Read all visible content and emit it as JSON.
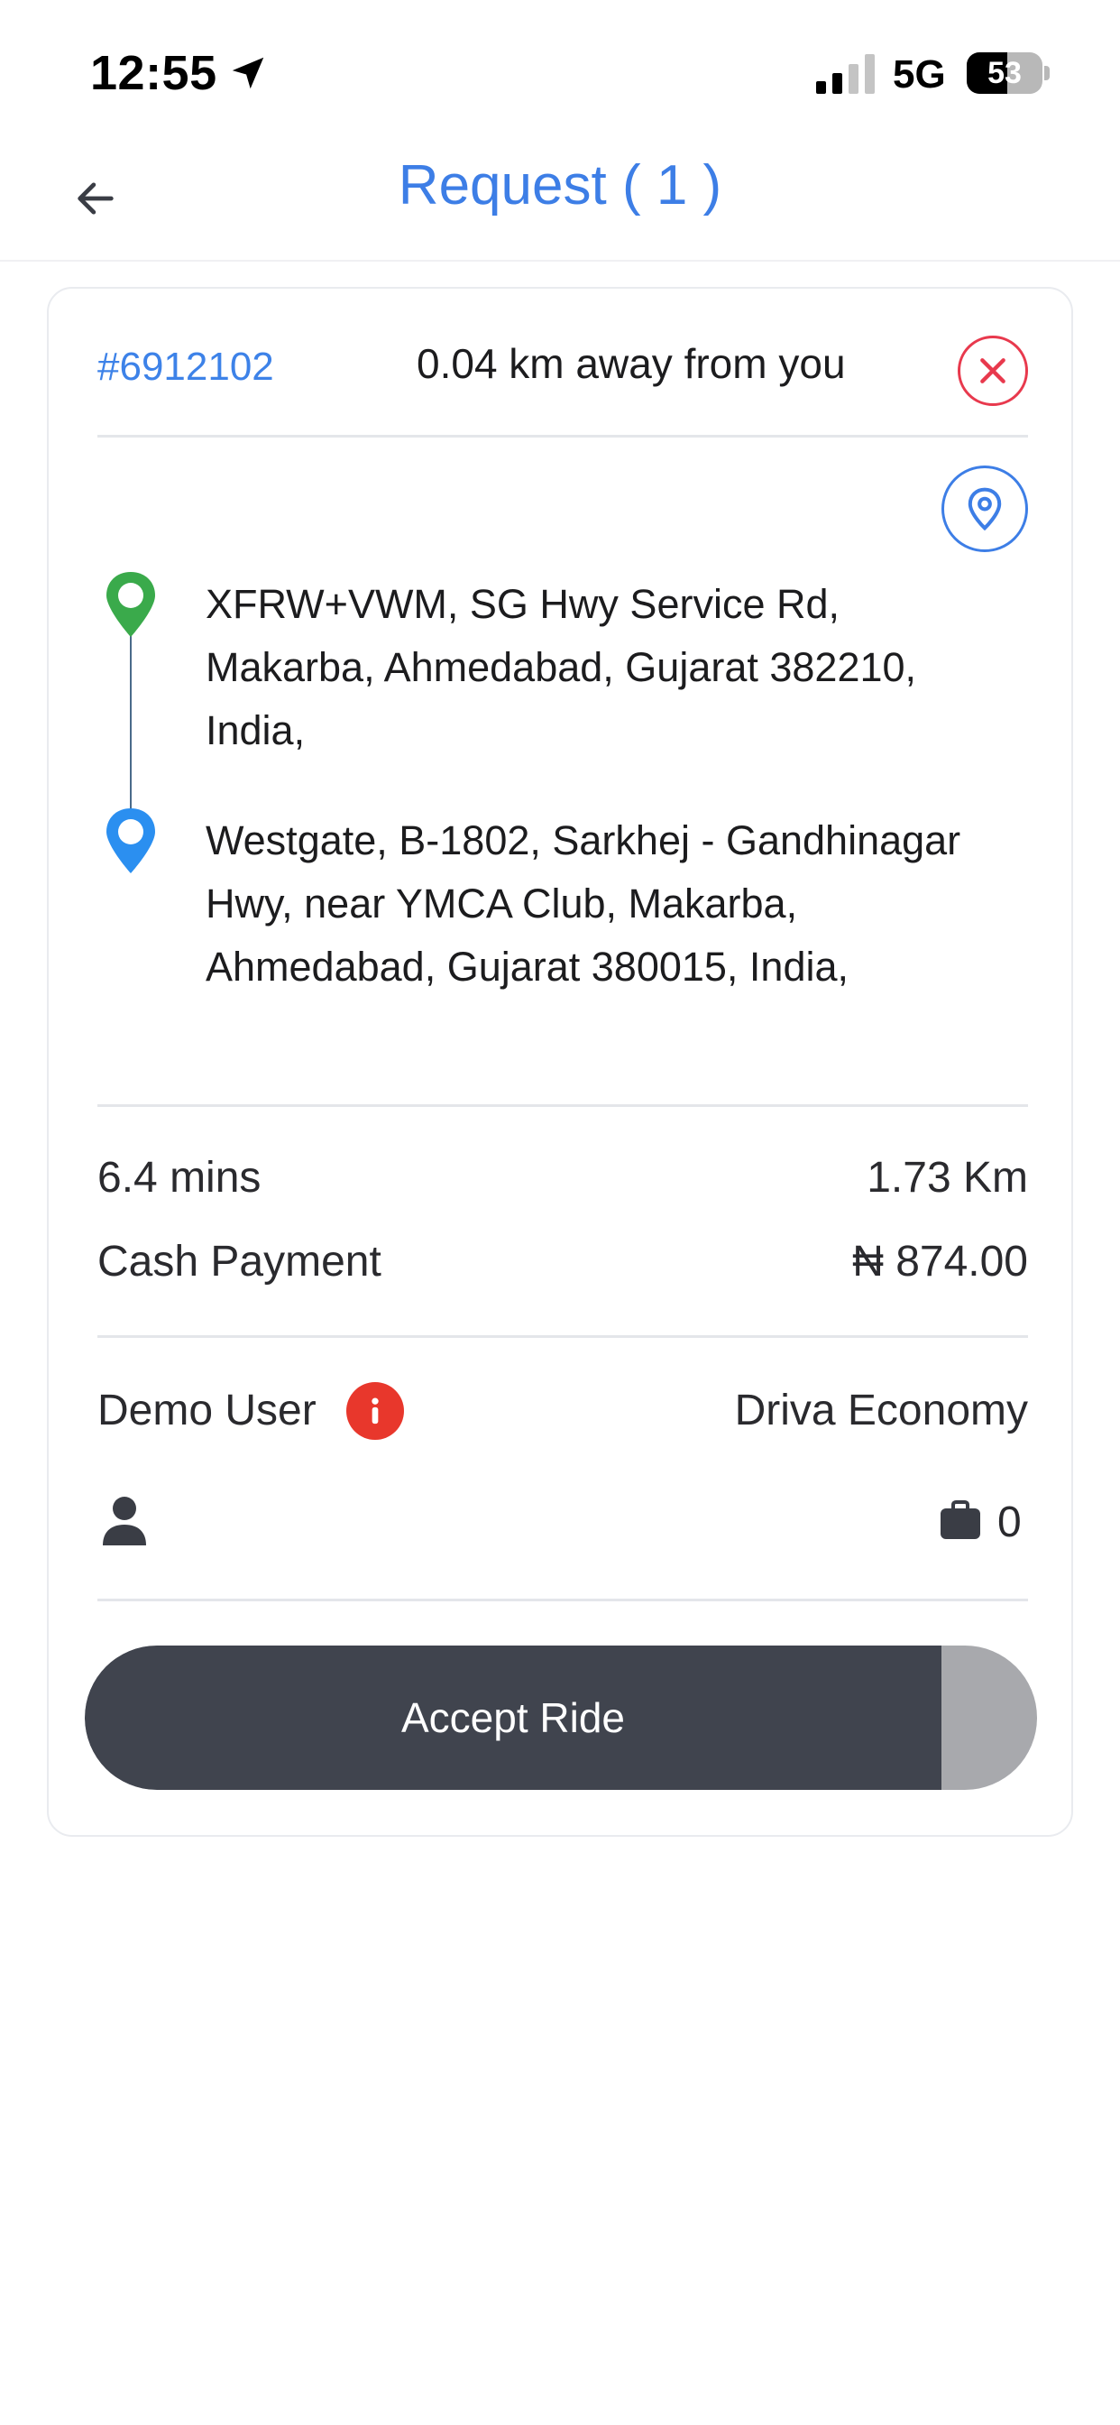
{
  "status_bar": {
    "time": "12:55",
    "network": "5G",
    "battery_level": "53",
    "battery_fraction": 0.53,
    "signal_bars_active": 2,
    "signal_bars_total": 4
  },
  "header": {
    "title": "Request ( 1 )"
  },
  "request": {
    "id": "#6912102",
    "distance_text": "0.04 km away from you",
    "pickup_address": "XFRW+VWM, SG Hwy Service Rd, Makarba, Ahmedabad, Gujarat 382210, India,",
    "dropoff_address": "Westgate,  B-1802, Sarkhej - Gandhinagar Hwy, near YMCA Club, Makarba, Ahmedabad, Gujarat 380015, India,",
    "duration": "6.4 mins",
    "trip_distance": "1.73 Km",
    "payment_method": "Cash Payment",
    "fare": "₦ 874.00",
    "rider_name": "Demo User",
    "vehicle_type": "Driva Economy",
    "luggage_count": "0",
    "accept_label": "Accept Ride",
    "swipe_progress": 0.9
  },
  "icons": {
    "back": "arrow-left-icon",
    "close": "close-icon",
    "map_pin": "map-pin-icon",
    "pickup": "pickup-pin-icon",
    "dropoff": "dropoff-pin-icon",
    "info": "info-icon",
    "user": "user-icon",
    "luggage": "briefcase-icon",
    "location": "location-arrow-icon"
  },
  "colors": {
    "accent": "#3d7ee6",
    "pickup_pin": "#3aaa4b",
    "dropoff_pin": "#2b8ff0",
    "close": "#e8394d",
    "info": "#e8372c",
    "accept_fill": "#40444e",
    "accept_track": "#a8a9ad"
  }
}
